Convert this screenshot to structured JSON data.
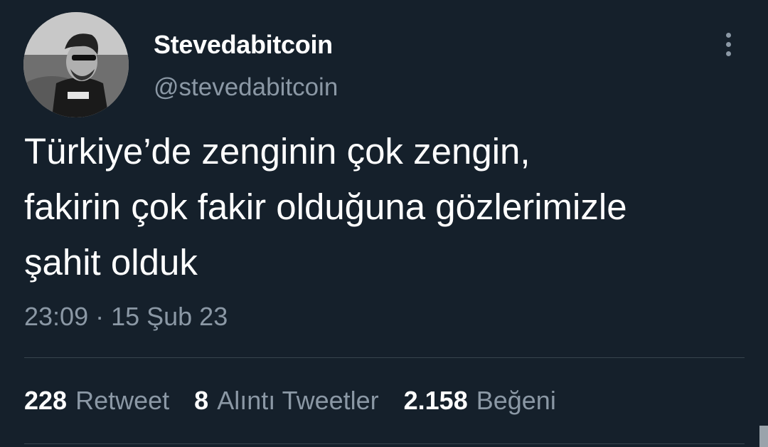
{
  "user": {
    "display_name": "Stevedabitcoin",
    "handle": "@stevedabitcoin"
  },
  "tweet": {
    "text_lines": [
      "Türkiye’de zenginin çok zengin,",
      "fakirin çok fakir olduğuna gözlerimizle",
      "şahit olduk"
    ],
    "timestamp": "23:09 · 15 Şub 23"
  },
  "stats": {
    "retweets": {
      "count": "228",
      "label": "Retweet"
    },
    "quotes": {
      "count": "8",
      "label": "Alıntı Tweetler"
    },
    "likes": {
      "count": "2.158",
      "label": "Beğeni"
    }
  },
  "icons": {
    "more": "more-vertical-icon"
  },
  "colors": {
    "background": "#15202b",
    "primary_text": "#ffffff",
    "secondary_text": "#8b98a5",
    "divider": "#38444d"
  }
}
